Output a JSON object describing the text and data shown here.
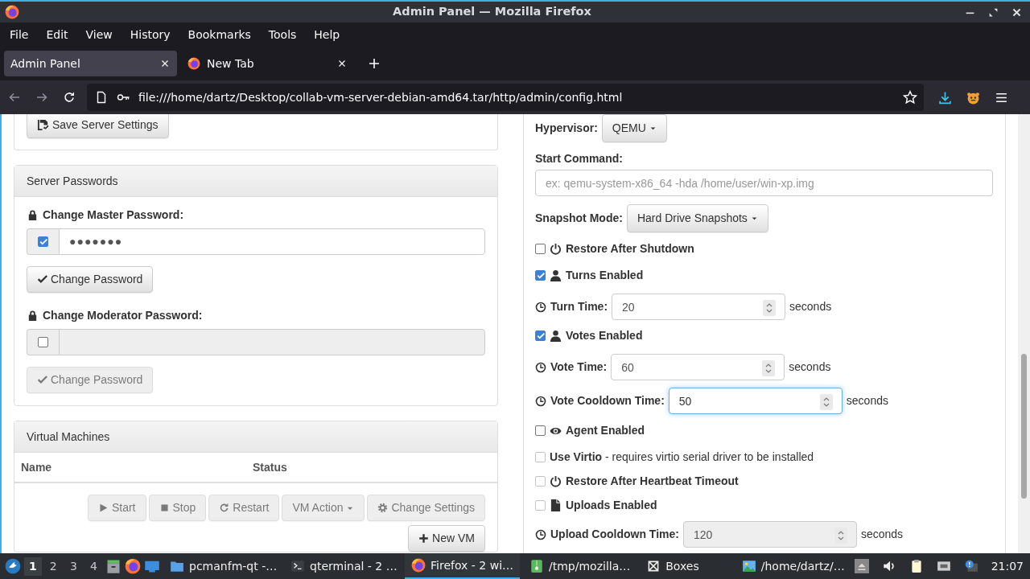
{
  "window": {
    "title": "Admin Panel — Mozilla Firefox"
  },
  "menu": [
    {
      "label": "File"
    },
    {
      "label": "Edit"
    },
    {
      "label": "View"
    },
    {
      "label": "History"
    },
    {
      "label": "Bookmarks"
    },
    {
      "label": "Tools"
    },
    {
      "label": "Help"
    }
  ],
  "tabs": [
    {
      "label": "Admin Panel",
      "selected": true,
      "favicon": false
    },
    {
      "label": "New Tab",
      "selected": false,
      "favicon": true
    }
  ],
  "address_bar": {
    "url": "file:///home/dartz/Desktop/collab-vm-server-debian-amd64.tar/http/admin/config.html"
  },
  "server_settings": {
    "save_button": "Save Server Settings"
  },
  "server_passwords": {
    "title": "Server Passwords",
    "fields": [
      {
        "label": "Change Master Password:",
        "checked": true,
        "value": "●●●●●●●",
        "button": "Change Password"
      },
      {
        "label": "Change Moderator Password:",
        "checked": false,
        "button": "Change Password"
      }
    ]
  },
  "virtual_machines": {
    "title": "Virtual Machines",
    "columns": [
      "Name",
      "Status"
    ],
    "actions_disabled": true,
    "actions": [
      {
        "label": "Start",
        "kind": "play"
      },
      {
        "label": "Stop",
        "kind": "stop"
      },
      {
        "label": "Restart",
        "kind": "refresh"
      },
      {
        "label": "VM Action",
        "kind": "dropdown"
      },
      {
        "label": "Change Settings",
        "kind": "gear"
      }
    ],
    "new_button": "New VM"
  },
  "vm_settings": {
    "rows": [
      {
        "kind": "dropdown",
        "label": "Hypervisor:",
        "value": "QEMU"
      },
      {
        "kind": "text",
        "label": "Start Command:",
        "placeholder": "ex: qemu-system-x86_64 -hda /home/user/win-xp.img"
      },
      {
        "kind": "dropdown",
        "label": "Snapshot Mode:",
        "value": "Hard Drive Snapshots"
      },
      {
        "kind": "checkbox",
        "label": "Restore After Shutdown",
        "checked": false,
        "disabled": false
      },
      {
        "kind": "checkbox",
        "label": "Turns Enabled",
        "checked": true,
        "disabled": false
      },
      {
        "kind": "number",
        "label": "Turn Time:",
        "value": "20",
        "unit": "seconds",
        "focused": false,
        "disabled": false
      },
      {
        "kind": "checkbox",
        "label": "Votes Enabled",
        "checked": true,
        "disabled": false
      },
      {
        "kind": "number",
        "label": "Vote Time:",
        "value": "60",
        "unit": "seconds",
        "focused": false,
        "disabled": false
      },
      {
        "kind": "number",
        "label": "Vote Cooldown Time:",
        "value": "50",
        "unit": "seconds",
        "focused": true,
        "disabled": false
      },
      {
        "kind": "checkbox",
        "label": "Agent Enabled",
        "checked": false,
        "disabled": false
      },
      {
        "kind": "checkbox",
        "label": "Use Virtio",
        "note": "- requires virtio serial driver to be installed",
        "checked": false,
        "disabled": true
      },
      {
        "kind": "checkbox",
        "label": "Restore After Heartbeat Timeout",
        "checked": false,
        "disabled": true
      },
      {
        "kind": "checkbox",
        "label": "Uploads Enabled",
        "checked": false,
        "disabled": true
      },
      {
        "kind": "number",
        "label": "Upload Cooldown Time:",
        "value": "120",
        "unit": "seconds",
        "focused": false,
        "disabled": true
      }
    ]
  },
  "taskbar": {
    "desktops": [
      {
        "label": "1",
        "selected": true
      },
      {
        "label": "2",
        "selected": false
      },
      {
        "label": "3",
        "selected": false
      },
      {
        "label": "4",
        "selected": false
      }
    ],
    "tasks": [
      {
        "label": "pcmanfm-qt -…",
        "selected": false
      },
      {
        "label": "qterminal - 2 …",
        "selected": false
      },
      {
        "label": "Firefox - 2 wi…",
        "selected": true
      },
      {
        "label": "/tmp/mozilla…",
        "selected": false
      },
      {
        "label": "Boxes",
        "selected": false
      },
      {
        "label": "/home/dartz/…",
        "selected": false
      }
    ],
    "clock": "21:07"
  }
}
